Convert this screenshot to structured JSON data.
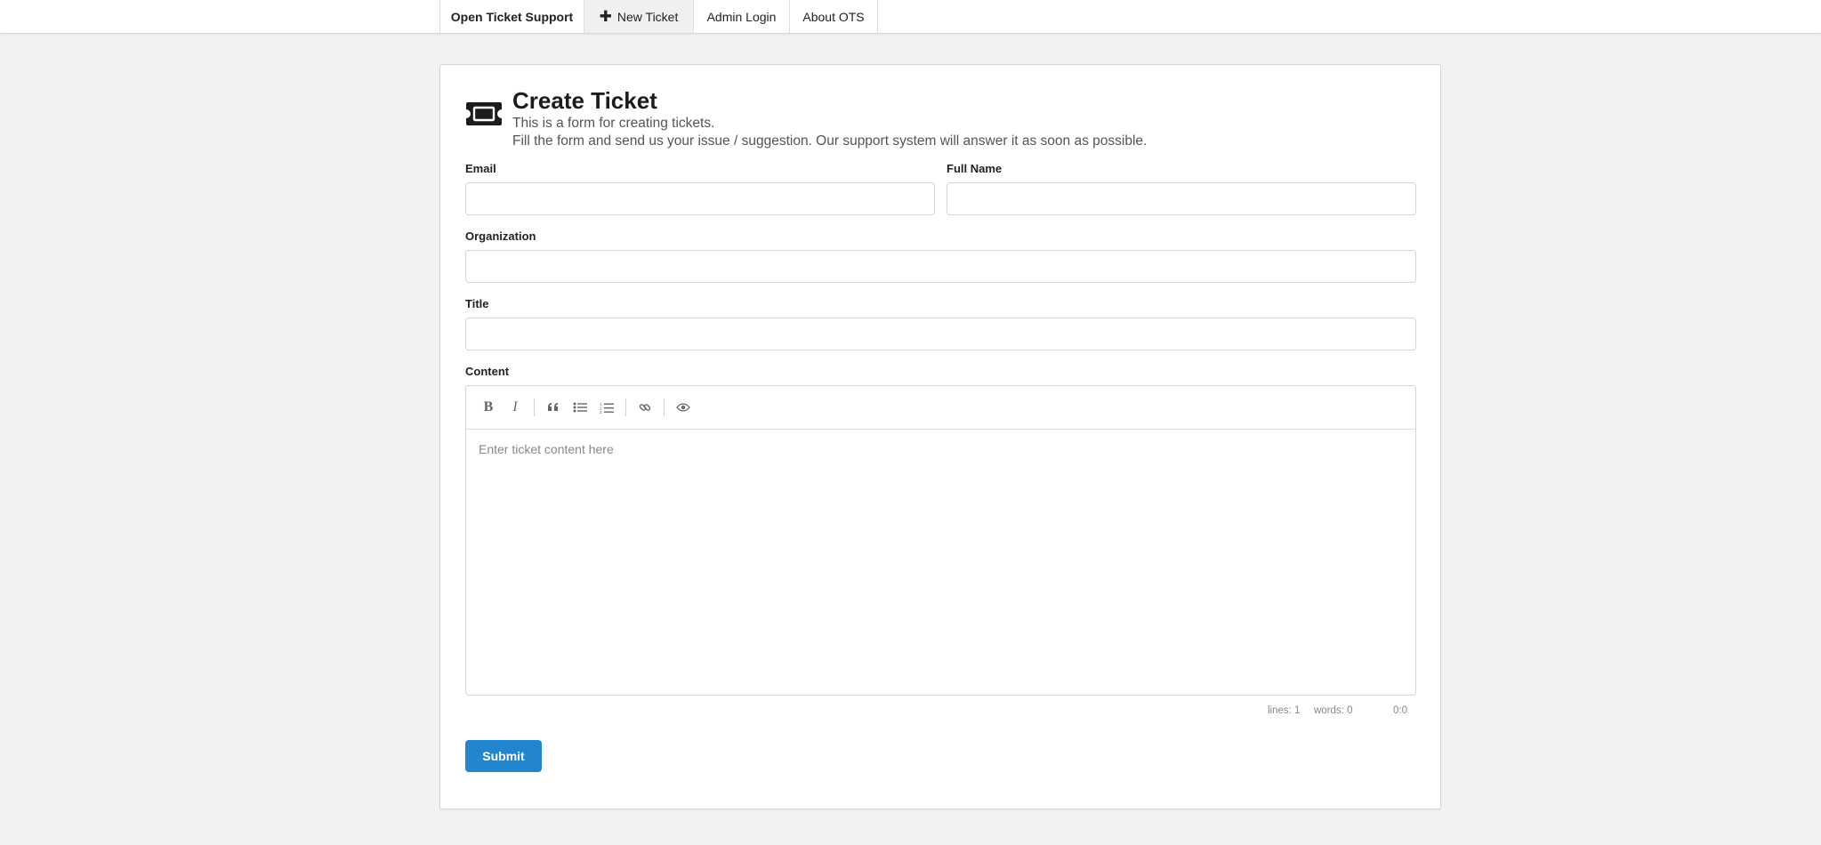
{
  "nav": {
    "brand": "Open Ticket Support",
    "new_ticket": "New Ticket",
    "admin_login": "Admin Login",
    "about": "About OTS"
  },
  "header": {
    "title": "Create Ticket",
    "subtitle_line1": "This is a form for creating tickets.",
    "subtitle_line2": "Fill the form and send us your issue / suggestion. Our support system will answer it as soon as possible."
  },
  "form": {
    "email_label": "Email",
    "email_value": "",
    "fullname_label": "Full Name",
    "fullname_value": "",
    "organization_label": "Organization",
    "organization_value": "",
    "title_label": "Title",
    "title_value": "",
    "content_label": "Content",
    "content_placeholder": "Enter ticket content here",
    "submit_label": "Submit"
  },
  "editor": {
    "toolbar": [
      "bold-icon",
      "italic-icon",
      "quote-icon",
      "unordered-list-icon",
      "ordered-list-icon",
      "link-icon",
      "preview-eye-icon"
    ],
    "status_lines": "lines: 1",
    "status_words": "words: 0",
    "status_cursor": "0:0"
  },
  "colors": {
    "accent": "#2185d0",
    "background": "#f2f2f2"
  }
}
